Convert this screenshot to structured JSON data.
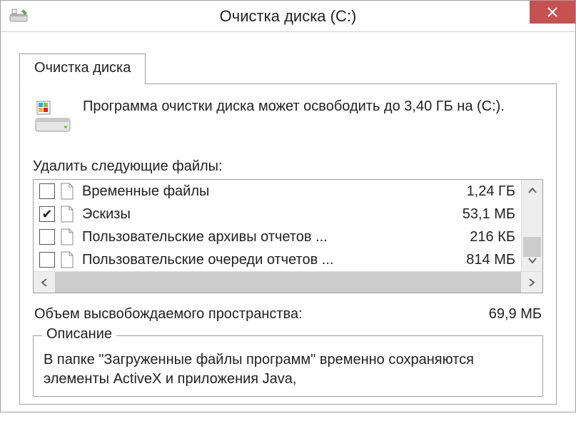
{
  "window": {
    "title": "Очистка диска  (C:)"
  },
  "tab": {
    "label": "Очистка диска"
  },
  "intro": "Программа очистки диска может освободить до 3,40 ГБ на  (C:).",
  "list_label": "Удалить следующие файлы:",
  "files": [
    {
      "checked": false,
      "name": "Временные файлы",
      "size": "1,24 ГБ"
    },
    {
      "checked": true,
      "name": "Эскизы",
      "size": "53,1 МБ"
    },
    {
      "checked": false,
      "name": "Пользовательские архивы отчетов ...",
      "size": "216 КБ"
    },
    {
      "checked": false,
      "name": "Пользовательские очереди отчетов ...",
      "size": "814 МБ"
    }
  ],
  "total": {
    "label": "Объем высвобождаемого пространства:",
    "value": "69,9 МБ"
  },
  "description": {
    "title": "Описание",
    "body": "В папке \"Загруженные файлы программ\" временно сохраняются элементы ActiveX и приложения Java,"
  }
}
